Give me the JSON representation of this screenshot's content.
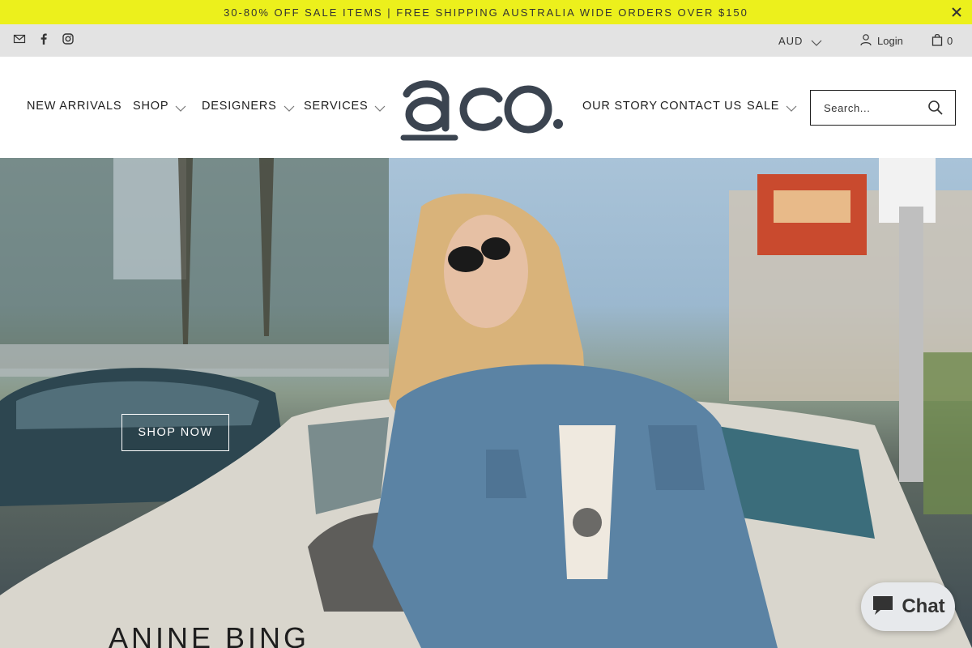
{
  "announcement": {
    "text": "30-80% OFF SALE ITEMS | FREE SHIPPING AUSTRALIA WIDE ORDERS OVER $150",
    "close_icon": "close-icon"
  },
  "utility": {
    "social_icons": [
      "email-icon",
      "facebook-icon",
      "instagram-icon"
    ],
    "currency": "AUD",
    "login_label": "Login",
    "cart_count": "0"
  },
  "nav": {
    "left": [
      {
        "label": "NEW ARRIVALS",
        "dropdown": false
      },
      {
        "label": "SHOP",
        "dropdown": true
      },
      {
        "label": "DESIGNERS",
        "dropdown": true
      },
      {
        "label": "SERVICES",
        "dropdown": true
      }
    ],
    "right": [
      {
        "label": "OUR STORY",
        "dropdown": false
      },
      {
        "label": "CONTACT US",
        "dropdown": false
      },
      {
        "label": "SALE",
        "dropdown": true
      }
    ]
  },
  "logo": {
    "text": "aco."
  },
  "search": {
    "placeholder": "Search..."
  },
  "hero": {
    "button_label": "SHOP NOW",
    "brand_title": "ANINE BING"
  },
  "chat": {
    "label": "Chat"
  },
  "colors": {
    "announcement_bg": "#ecf01c",
    "utility_bg": "#e3e3e3",
    "logo": "#3b4450"
  }
}
